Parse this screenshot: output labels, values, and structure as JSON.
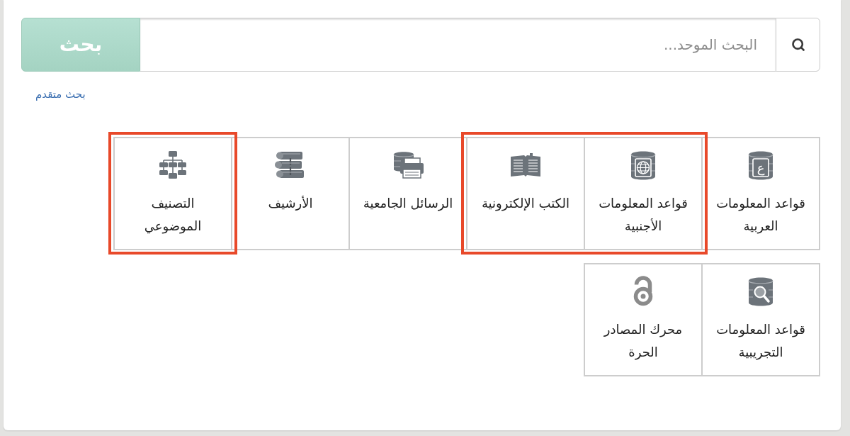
{
  "search": {
    "placeholder": "البحث الموحد...",
    "button": "بحث"
  },
  "advanced_search_link": "بحث متقدم",
  "tiles": [
    {
      "kind": "letter",
      "icon_text": "ع",
      "label": "قواعد المعلومات\nالعربية",
      "highlighted": false
    },
    {
      "kind": "globe",
      "label": "قواعد المعلومات\nالأجنبية",
      "highlighted": true
    },
    {
      "kind": "book",
      "label": "الكتب الإلكترونية",
      "highlighted": true
    },
    {
      "kind": "printer",
      "label": "الرسائل الجامعية",
      "highlighted": false
    },
    {
      "kind": "shelf",
      "label": "الأرشيف",
      "highlighted": false
    },
    {
      "kind": "chart",
      "label": "التصنيف\nالموضوعي",
      "highlighted": true
    },
    {
      "kind": "search",
      "label": "قواعد المعلومات\nالتجريبية",
      "highlighted": false
    },
    {
      "kind": "lock",
      "label": "محرك المصادر\nالحرة",
      "highlighted": false
    }
  ]
}
